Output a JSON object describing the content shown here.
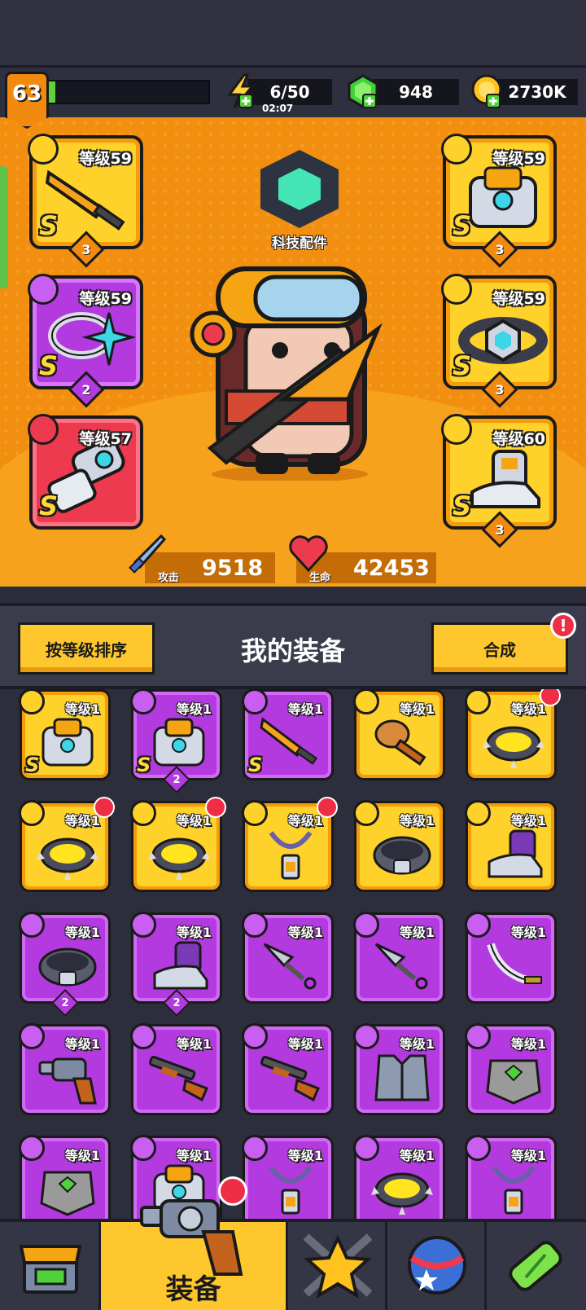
{
  "header": {
    "player_level": "63",
    "energy": "6/50",
    "energy_timer": "02:07",
    "gems": "948",
    "coins": "2730K"
  },
  "hero": {
    "tech_label": "科技配件",
    "attack_label": "攻击",
    "attack_value": "9518",
    "hp_label": "生命",
    "hp_value": "42453",
    "slots": [
      {
        "level": "等级59",
        "grade": "S",
        "stars": "3",
        "rarity": "yellow",
        "item": "sword"
      },
      {
        "level": "等级59",
        "grade": "S",
        "stars": "2",
        "rarity": "purple",
        "item": "ring"
      },
      {
        "level": "等级57",
        "grade": "S",
        "stars": "",
        "rarity": "red",
        "item": "gauntlet"
      },
      {
        "level": "等级59",
        "grade": "S",
        "stars": "3",
        "rarity": "yellow",
        "item": "armor"
      },
      {
        "level": "等级59",
        "grade": "S",
        "stars": "3",
        "rarity": "yellow",
        "item": "belt"
      },
      {
        "level": "等级60",
        "grade": "S",
        "stars": "3",
        "rarity": "yellow",
        "item": "boots"
      }
    ]
  },
  "inventory": {
    "sort_button": "按等级排序",
    "title": "我的装备",
    "merge_button": "合成",
    "alert": "!",
    "items": [
      {
        "level": "等级1",
        "rarity": "yellow",
        "grade": "S",
        "stars": "",
        "dot": false,
        "item": "armor"
      },
      {
        "level": "等级1",
        "rarity": "purple",
        "grade": "S",
        "stars": "2",
        "dot": false,
        "item": "armor"
      },
      {
        "level": "等级1",
        "rarity": "purple",
        "grade": "S",
        "stars": "",
        "dot": false,
        "item": "sword"
      },
      {
        "level": "等级1",
        "rarity": "yellow",
        "grade": "",
        "stars": "",
        "dot": false,
        "item": "club"
      },
      {
        "level": "等级1",
        "rarity": "yellow",
        "grade": "",
        "stars": "",
        "dot": true,
        "item": "collar"
      },
      {
        "level": "等级1",
        "rarity": "yellow",
        "grade": "",
        "stars": "",
        "dot": true,
        "item": "collar"
      },
      {
        "level": "等级1",
        "rarity": "yellow",
        "grade": "",
        "stars": "",
        "dot": true,
        "item": "collar"
      },
      {
        "level": "等级1",
        "rarity": "yellow",
        "grade": "",
        "stars": "",
        "dot": true,
        "item": "amulet"
      },
      {
        "level": "等级1",
        "rarity": "yellow",
        "grade": "",
        "stars": "",
        "dot": false,
        "item": "belt"
      },
      {
        "level": "等级1",
        "rarity": "yellow",
        "grade": "",
        "stars": "",
        "dot": false,
        "item": "boots"
      },
      {
        "level": "等级1",
        "rarity": "purple",
        "grade": "",
        "stars": "2",
        "dot": false,
        "item": "belt"
      },
      {
        "level": "等级1",
        "rarity": "purple",
        "grade": "",
        "stars": "2",
        "dot": false,
        "item": "boots"
      },
      {
        "level": "等级1",
        "rarity": "purple",
        "grade": "",
        "stars": "",
        "dot": false,
        "item": "kunai"
      },
      {
        "level": "等级1",
        "rarity": "purple",
        "grade": "",
        "stars": "",
        "dot": false,
        "item": "kunai"
      },
      {
        "level": "等级1",
        "rarity": "purple",
        "grade": "",
        "stars": "",
        "dot": false,
        "item": "scimitar"
      },
      {
        "level": "等级1",
        "rarity": "purple",
        "grade": "",
        "stars": "",
        "dot": false,
        "item": "revolver"
      },
      {
        "level": "等级1",
        "rarity": "purple",
        "grade": "",
        "stars": "",
        "dot": false,
        "item": "shotgun"
      },
      {
        "level": "等级1",
        "rarity": "purple",
        "grade": "",
        "stars": "",
        "dot": false,
        "item": "shotgun"
      },
      {
        "level": "等级1",
        "rarity": "purple",
        "grade": "",
        "stars": "",
        "dot": false,
        "item": "vest"
      },
      {
        "level": "等级1",
        "rarity": "purple",
        "grade": "",
        "stars": "",
        "dot": false,
        "item": "rock-armor"
      },
      {
        "level": "等级1",
        "rarity": "purple",
        "grade": "",
        "stars": "",
        "dot": false,
        "item": "rock-armor"
      },
      {
        "level": "等级1",
        "rarity": "purple",
        "grade": "",
        "stars": "",
        "dot": false,
        "item": "armor"
      },
      {
        "level": "等级1",
        "rarity": "purple",
        "grade": "",
        "stars": "",
        "dot": false,
        "item": "amulet"
      },
      {
        "level": "等级1",
        "rarity": "purple",
        "grade": "",
        "stars": "",
        "dot": false,
        "item": "collar"
      },
      {
        "level": "等级1",
        "rarity": "purple",
        "grade": "",
        "stars": "",
        "dot": false,
        "item": "amulet"
      }
    ]
  },
  "nav": {
    "tabs": [
      {
        "name": "shop",
        "label": ""
      },
      {
        "name": "equipment",
        "label": "装备"
      },
      {
        "name": "battle",
        "label": ""
      },
      {
        "name": "talents",
        "label": ""
      },
      {
        "name": "evolve",
        "label": ""
      }
    ]
  },
  "colors": {
    "hero_bg": "#f28f10",
    "rarity_yellow": "#fed22b",
    "rarity_purple": "#b23adf",
    "rarity_red": "#ee3a4e",
    "panel_dark": "#2c2e3b"
  }
}
